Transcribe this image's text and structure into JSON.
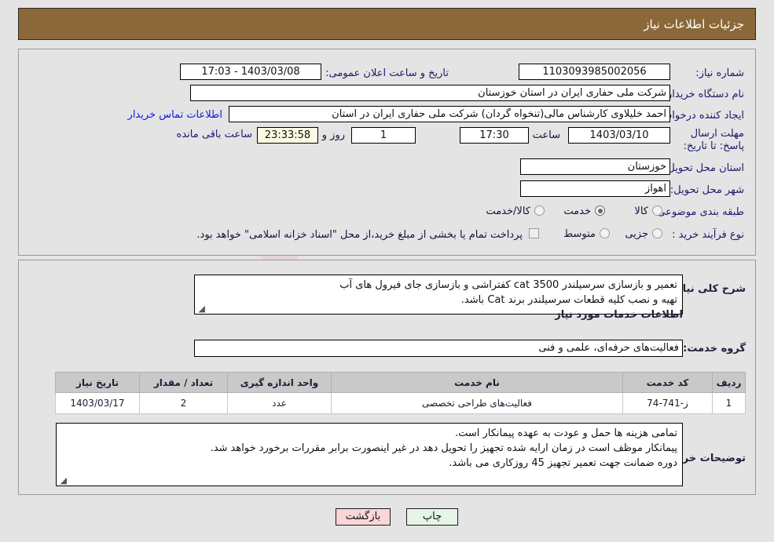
{
  "window": {
    "title": "جزئیات اطلاعات نیاز"
  },
  "watermark": {
    "text": "AriaTender.net"
  },
  "summary": {
    "need_number_label": "شماره نیاز:",
    "need_number_value": "1103093985002056",
    "announce_datetime_label": "تاریخ و ساعت اعلان عمومی:",
    "announce_datetime_value": "1403/03/08 - 17:03",
    "buyer_org_label": "نام دستگاه خریدار:",
    "buyer_org_value": "شرکت ملی حفاری ایران در استان خوزستان",
    "creator_label": "ایجاد کننده درخواست:",
    "creator_value": "احمد خلیلاوی کارشناس مالی(تنخواه گردان) شرکت ملی حفاری ایران در استان",
    "contact_link": "اطلاعات تماس خریدار",
    "deadline_label": "مهلت ارسال پاسخ: تا تاریخ:",
    "deadline_date": "1403/03/10",
    "deadline_time_label": "ساعت",
    "deadline_time": "17:30",
    "remaining_days": "1",
    "remaining_days_label": "روز و",
    "remaining_clock": "23:33:58",
    "remaining_suffix": "ساعت باقی مانده",
    "province_label": "استان محل تحویل:",
    "province_value": "خوزستان",
    "city_label": "شهر محل تحویل:",
    "city_value": "اهواز",
    "category_label": "طبقه بندی موضوعی:",
    "category_options": [
      {
        "label": "کالا",
        "selected": false
      },
      {
        "label": "خدمت",
        "selected": true
      },
      {
        "label": "کالا/خدمت",
        "selected": false
      }
    ],
    "process_label": "نوع فرآیند خرید :",
    "process_options": [
      {
        "label": "جزیی",
        "selected": false
      },
      {
        "label": "متوسط",
        "selected": false
      }
    ],
    "treasury_checkbox_checked": false,
    "treasury_note": "پرداخت تمام یا بخشی از مبلغ خرید،از محل \"اسناد خزانه اسلامی\" خواهد بود."
  },
  "details": {
    "general_desc_label": "شرح کلی نیاز:",
    "general_desc_line1": "تعمیر و بازسازی سرسیلندر cat 3500 کفتراشی و بازسازی جای فیرول های آب",
    "general_desc_line2": "تهیه و نصب کلیه قطعات سرسیلندر برند Cat باشد.",
    "services_heading": "اطلاعات خدمات مورد نیاز",
    "service_group_label": "گروه خدمت:",
    "service_group_value": "فعالیت‌های حرفه‌ای، علمی و فنی"
  },
  "table": {
    "headers": [
      "ردیف",
      "کد خدمت",
      "نام خدمت",
      "واحد اندازه گیری",
      "تعداد / مقدار",
      "تاریخ نیاز"
    ],
    "rows": [
      {
        "index": "1",
        "service_code": "ز-741-74",
        "service_name": "فعالیت‌های طراحی تخصصی",
        "unit": "عدد",
        "quantity": "2",
        "need_date": "1403/03/17"
      }
    ]
  },
  "buyer_notes": {
    "label": "توضیحات خریدار:",
    "line1": "تمامی هزینه ها حمل و عودت به عهده پیمانکار است.",
    "line2": "پیمانکار موظف است در زمان ارایه شده تجهیز را تحویل دهد در غیر اینصورت برابر مقررات برخورد خواهد شد.",
    "line3": "دوره ضمانت جهت تعمیر تجهیز 45 روزکاری می باشد."
  },
  "footer": {
    "print_label": "چاپ",
    "back_label": "بازگشت"
  },
  "colors": {
    "titlebar": "#8b6839",
    "label_blue": "#1a1a6e",
    "link_blue": "#1515e0",
    "print_btn": "#e6f6e6",
    "back_btn": "#fbd6d6",
    "page_bg": "#e4e4e4"
  }
}
